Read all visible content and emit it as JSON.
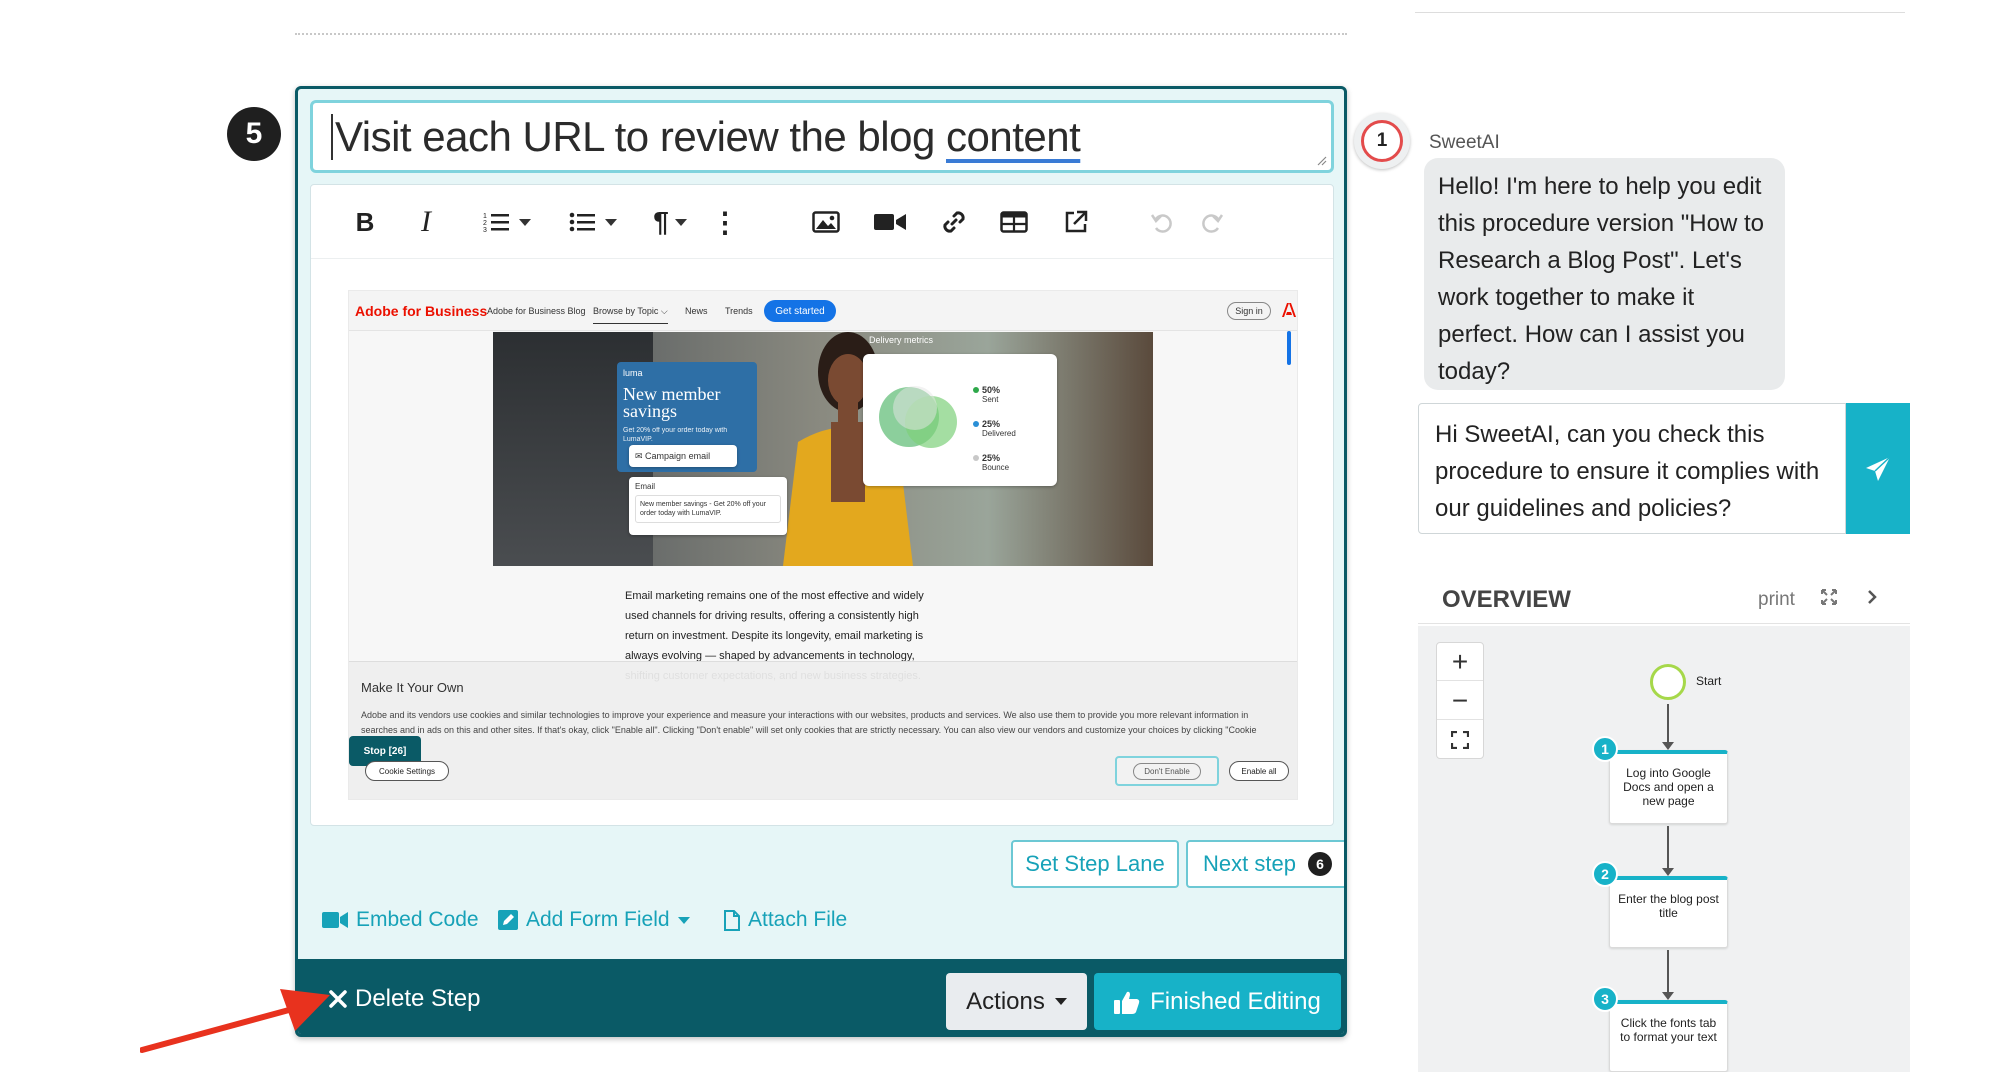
{
  "step": {
    "number": "5",
    "title_before": "Visit each URL to review the blog ",
    "title_underlined": "content"
  },
  "toolbar": {
    "bold_label": "B",
    "italic_label": "I",
    "paragraph_label": "¶",
    "more_label": "⋮",
    "icons": [
      "bold-icon",
      "italic-icon",
      "ordered-list-icon",
      "bullet-list-icon",
      "paragraph-icon",
      "more-icon",
      "image-icon",
      "video-icon",
      "link-icon",
      "table-icon",
      "external-link-icon",
      "undo-icon",
      "redo-icon"
    ]
  },
  "embedded": {
    "logo": "Adobe for Business",
    "nav_links": [
      "Adobe for Business Blog",
      "Browse by Topic ⌵",
      "News",
      "Trends"
    ],
    "cta": "Get started",
    "signin": "Sign in",
    "hero": {
      "brand": "luma",
      "headline": "New member savings",
      "sub": "Get 20% off your order today with LumaVIP.",
      "chip": "✉ Campaign email",
      "email_label": "Email",
      "email_text": "New member savings - Get 20% off your order today with LumaVIP.",
      "metrics_title": "Delivery metrics",
      "metrics": [
        {
          "value": "50%",
          "label": "Sent",
          "color": "#2ea84a"
        },
        {
          "value": "25%",
          "label": "Delivered",
          "color": "#2a8fd6"
        },
        {
          "value": "25%",
          "label": "Bounce",
          "color": "#c8c8c8"
        }
      ]
    },
    "article": "Email marketing remains one of the most effective and widely used channels for driving results, offering a consistently high return on investment. Despite its longevity, email marketing is always evolving — shaped by advancements in technology, shifting customer expectations, and new business strategies.",
    "cookie": {
      "title": "Make It Your Own",
      "text": "Adobe and its vendors use cookies and similar technologies to improve your experience and measure your interactions with our websites, products and services. We also use them to provide you more relevant information in searches and in ads on this and other sites. If that's okay, click \"Enable all\". Clicking \"Don't enable\" will set only cookies that are strictly necessary. You can also view our vendors and customize your choices by clicking \"Cookie Settings\".",
      "settings": "Cookie Settings",
      "dont_enable": "Don't Enable",
      "enable_all": "Enable all",
      "stop_badge": "Stop [26]"
    }
  },
  "controls": {
    "set_step_lane": "Set Step Lane",
    "next_step": "Next step",
    "next_step_number": "6",
    "embed_code": "Embed Code",
    "add_form_field": "Add Form Field",
    "attach_file": "Attach File",
    "delete_step": "Delete Step",
    "actions": "Actions",
    "finished_editing": "Finished Editing"
  },
  "comment_badge": {
    "count": "1"
  },
  "chat": {
    "assistant_name": "SweetAI",
    "assistant_message": "Hello! I'm here to help you edit this procedure version \"How to Research a Blog Post\". Let's work together to make it perfect. How can I assist you today?",
    "input_value": "Hi SweetAI, can you check this procedure to ensure it complies with our guidelines and policies?"
  },
  "overview": {
    "title": "OVERVIEW",
    "print": "print",
    "zoom_in": "+",
    "zoom_out": "−",
    "start_label": "Start",
    "steps": [
      {
        "num": "1",
        "label": "Log into Google Docs and open a new page"
      },
      {
        "num": "2",
        "label": "Enter the blog post title"
      },
      {
        "num": "3",
        "label": "Click the fonts tab to format your text"
      }
    ]
  },
  "colors": {
    "teal_dark": "#0a5a66",
    "teal_accent": "#17b2c8",
    "annotation_red": "#e8321e"
  }
}
